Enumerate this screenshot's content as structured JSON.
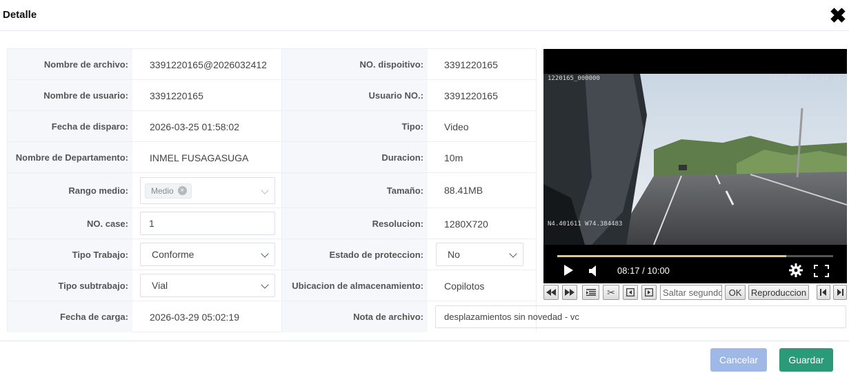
{
  "dialog": {
    "title": "Detalle"
  },
  "fields": {
    "file_name": {
      "label": "Nombre de archivo:",
      "value": "3391220165@2026032412"
    },
    "device_no": {
      "label": "NO. dispoitivo:",
      "value": "3391220165"
    },
    "user_name": {
      "label": "Nombre de usuario:",
      "value": "3391220165"
    },
    "user_no": {
      "label": "Usuario NO.:",
      "value": "3391220165"
    },
    "trigger_date": {
      "label": "Fecha de disparo:",
      "value": "2026-03-25 01:58:02"
    },
    "type": {
      "label": "Tipo:",
      "value": "Video"
    },
    "department": {
      "label": "Nombre de Departamento:",
      "value": "INMEL FUSAGASUGA"
    },
    "duration": {
      "label": "Duracion:",
      "value": "10m"
    },
    "mid_range": {
      "label": "Rango medio:",
      "tag": "Medio"
    },
    "size": {
      "label": "Tamaño:",
      "value": "88.41MB"
    },
    "case_no": {
      "label": "NO. case:",
      "value": "1"
    },
    "resolution": {
      "label": "Resolucion:",
      "value": "1280X720"
    },
    "work_type": {
      "label": "Tipo Trabajo:",
      "value": "Conforme"
    },
    "protection": {
      "label": "Estado de proteccion:",
      "value": "No"
    },
    "work_subtype": {
      "label": "Tipo subtrabajo:",
      "value": "Vial"
    },
    "storage": {
      "label": "Ubicacion de almacenamiento:",
      "value": "Copilotos"
    },
    "upload_date": {
      "label": "Fecha de carga:",
      "value": "2026-03-29 05:02:19"
    },
    "file_note": {
      "label": "Nota de archivo:",
      "value": "desplazamientos sin novedad - vc"
    }
  },
  "video": {
    "osd_top_left": "1220165_000000",
    "osd_top_right": "2026-03-24 12:56:19",
    "osd_gps": "N4.401611  W74.384483",
    "time": "08:17 / 10:00",
    "progress_fraction": 0.829
  },
  "controls": {
    "seek_placeholder": "Saltar segundo",
    "ok": "OK",
    "playback": "Reproduccion"
  },
  "footer": {
    "cancel": "Cancelar",
    "save": "Guardar"
  },
  "colors": {
    "save": "#2a9a78",
    "cancel": "#9fb8e6",
    "label_bg": "#f5f7fa"
  }
}
